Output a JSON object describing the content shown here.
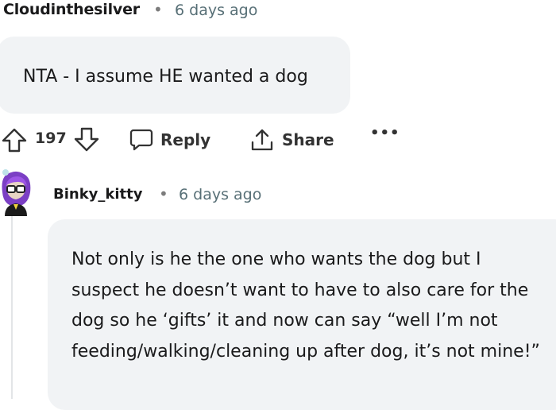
{
  "comments": [
    {
      "author": "Cloudinthesilver",
      "separator": "•",
      "time": "6 days ago",
      "body": "NTA - I assume HE wanted a dog",
      "actions": {
        "score": "197",
        "reply_label": "Reply",
        "share_label": "Share",
        "more_label": "•••"
      }
    },
    {
      "author": "Binky_kitty",
      "separator": "•",
      "time": "6 days ago",
      "body": "Not only is he the one who wants the dog but I suspect he doesn’t want to have to also care for the dog so he ‘gifts’ it and now can say “well I’m not feeding/walking/cleaning up after dog, it’s not mine!”"
    }
  ],
  "icons": {
    "upvote": "arrow-up-outline-icon",
    "downvote": "arrow-down-outline-icon",
    "reply": "speech-bubble-icon",
    "share": "share-upload-icon"
  },
  "colors": {
    "bubble_bg": "#f1f3f5",
    "meta_text": "#576f76",
    "avatar_hair": "#7b3fc4"
  }
}
